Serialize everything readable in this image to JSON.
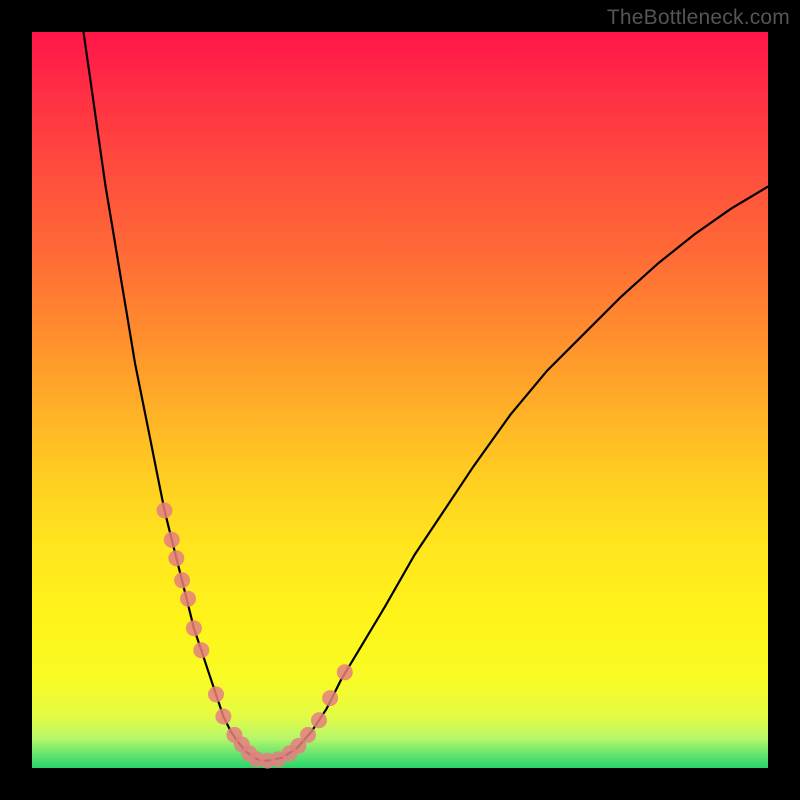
{
  "watermark": "TheBottleneck.com",
  "chart_data": {
    "type": "line",
    "title": "",
    "xlabel": "",
    "ylabel": "",
    "xlim": [
      0,
      100
    ],
    "ylim": [
      0,
      100
    ],
    "series": [
      {
        "name": "bottleneck-curve",
        "x": [
          7,
          8,
          9,
          10,
          11,
          12,
          13,
          14,
          15,
          16,
          17,
          18,
          19,
          20,
          21,
          22,
          23,
          24,
          25,
          26,
          27,
          28,
          29,
          30,
          31,
          32,
          34,
          36,
          38,
          40,
          42,
          45,
          48,
          52,
          56,
          60,
          65,
          70,
          75,
          80,
          85,
          90,
          95,
          100
        ],
        "y": [
          100,
          93,
          86,
          79,
          73,
          67,
          61,
          55,
          50,
          45,
          40,
          35,
          31,
          27,
          23,
          19,
          16,
          13,
          10,
          7,
          5,
          3.5,
          2.3,
          1.5,
          1,
          1,
          1.4,
          2.7,
          5,
          8,
          12,
          17,
          22,
          29,
          35,
          41,
          48,
          54,
          59,
          64,
          68.5,
          72.5,
          76,
          79
        ]
      }
    ],
    "scatter_on_curve": {
      "name": "markers",
      "x": [
        18,
        19,
        19.6,
        20.4,
        21.2,
        22,
        23,
        25,
        26,
        27.5,
        28.5,
        29.5,
        30.5,
        32,
        33.5,
        35,
        36.2,
        37.5,
        39,
        40.5,
        42.5
      ],
      "y": [
        35,
        31,
        28.5,
        25.5,
        23,
        19,
        16,
        10,
        7,
        4.5,
        3.2,
        2,
        1.2,
        1,
        1.2,
        2,
        3,
        4.5,
        6.5,
        9.5,
        13
      ]
    },
    "background_gradient": {
      "top": "#ff1648",
      "mid": "#ffe61e",
      "bottom": "#28d46a"
    }
  }
}
